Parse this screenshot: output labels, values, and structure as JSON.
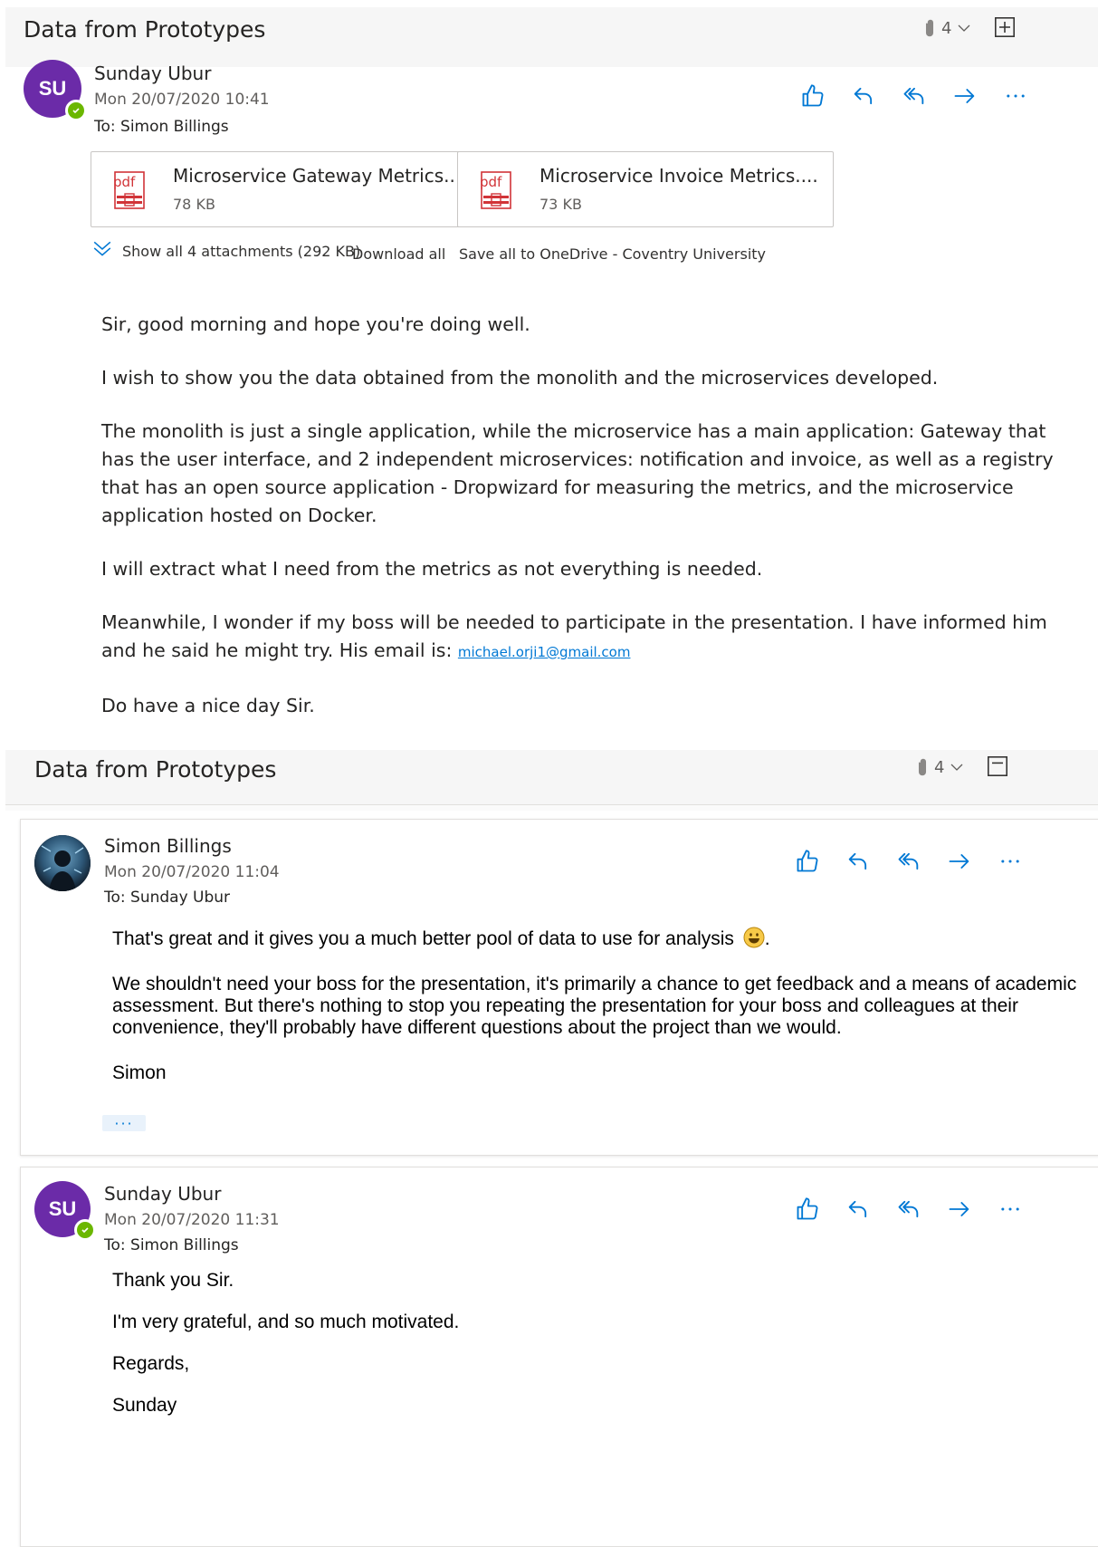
{
  "thread1": {
    "subject": "Data from Prototypes",
    "attachment_count": "4",
    "message": {
      "avatar_initials": "SU",
      "sender": "Sunday Ubur",
      "date": "Mon 20/07/2020 10:41",
      "to_label": "To:",
      "to_name": "Simon Billings",
      "attachments": [
        {
          "name": "Microservice Gateway Metrics...",
          "size": "78 KB",
          "type_label": "pdf"
        },
        {
          "name": "Microservice Invoice Metrics....",
          "size": "73 KB",
          "type_label": "pdf"
        }
      ],
      "show_all": "Show all 4 attachments (292 KB)",
      "download_all": "Download all",
      "save_all": "Save all to OneDrive - Coventry University",
      "body": {
        "p1": "Sir, good morning and hope you're doing well.",
        "p2": "I wish to show you the data obtained from the monolith and the microservices developed.",
        "p3": "The monolith is just a single application, while the microservice has a main application: Gateway that has the user interface, and 2 independent microservices: notification and invoice, as well as a registry that has an open source application - Dropwizard for measuring the metrics, and the microservice application hosted on Docker.",
        "p4": "I will extract what I need from the metrics as not everything is needed.",
        "p5": "Meanwhile, I wonder if my boss will be needed to participate in the presentation. I have informed him and he said he might try. His email is: ",
        "p5_email": "michael.orji1@gmail.com ",
        "p6": "Do have a nice day Sir."
      }
    }
  },
  "thread2": {
    "subject": "Data from Prototypes",
    "attachment_count": "4",
    "messages": [
      {
        "sender": "Simon Billings",
        "date": "Mon 20/07/2020 11:04",
        "to_label": "To:",
        "to_name": "Sunday Ubur",
        "body": {
          "p1": "That's great and it gives you a much better pool of data to use for analysis",
          "p2": "We shouldn't need your boss for the presentation, it's primarily a chance to get feedback and a means of academic assessment. But there's nothing to stop you repeating the presentation for your boss and colleagues at their convenience, they'll probably have different questions about the project than we would.",
          "p3": "Simon"
        },
        "more": "···"
      },
      {
        "avatar_initials": "SU",
        "sender": "Sunday Ubur",
        "date": "Mon 20/07/2020 11:31",
        "to_label": "To:",
        "to_name": "Simon Billings",
        "body": {
          "p1": "Thank you Sir.",
          "p2": "I'm very grateful,  and so much motivated.",
          "p3": "Regards,",
          "p4": "Sunday"
        }
      }
    ]
  },
  "colors": {
    "accent": "#0078d4",
    "avatar_purple": "#6b2ba8",
    "presence_green": "#6bb700",
    "pdf_red": "#d13438"
  }
}
